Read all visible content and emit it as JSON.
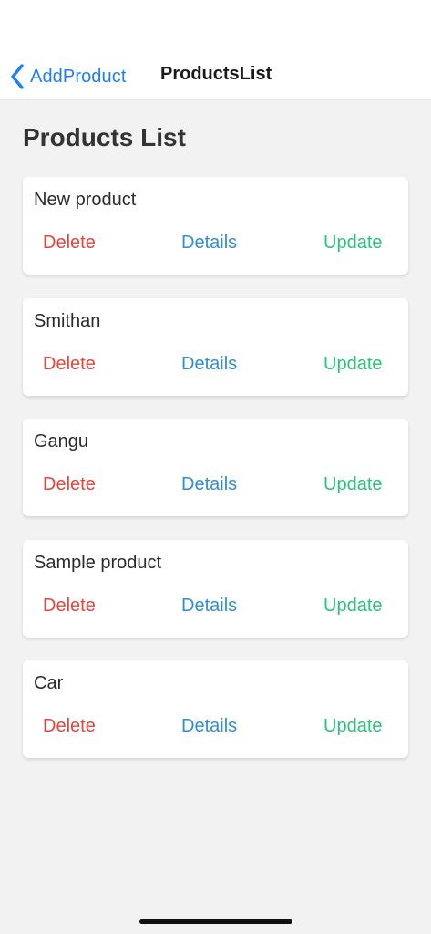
{
  "colors": {
    "nav_blue": "#1f7ff0",
    "delete_red": "#e2463b",
    "details_blue": "#2f8fd0",
    "update_green": "#2bc27a"
  },
  "nav": {
    "back_icon": "chevron-left-icon",
    "back_label": "AddProduct",
    "title": "ProductsList"
  },
  "page": {
    "title": "Products List"
  },
  "actions": {
    "delete": "Delete",
    "details": "Details",
    "update": "Update"
  },
  "products": [
    {
      "name": "New product"
    },
    {
      "name": "Smithan"
    },
    {
      "name": "Gangu"
    },
    {
      "name": "Sample product"
    },
    {
      "name": "Car"
    }
  ]
}
